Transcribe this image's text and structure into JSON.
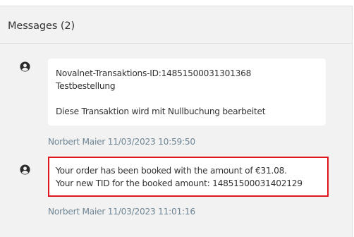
{
  "panel": {
    "title": "Messages (2)"
  },
  "messages": [
    {
      "avatar_icon": "user-icon",
      "lines": [
        "Novalnet-Transaktions-ID:14851500031301368",
        "Testbestellung",
        "",
        "Diese Transaktion wird mit Nullbuchung bearbeitet"
      ],
      "meta": "Norbert Maier 11/03/2023 10:59:50",
      "highlighted": false
    },
    {
      "avatar_icon": "user-icon",
      "lines": [
        "Your order has been booked with the amount of €31.08.",
        "Your new TID for the booked amount: 14851500031402129"
      ],
      "meta": "Norbert Maier 11/03/2023 11:01:16",
      "highlighted": true
    }
  ],
  "colors": {
    "panel_bg": "#f2f2f2",
    "bubble_bg": "#ffffff",
    "highlight_border": "#e0161e",
    "meta_text": "#6e8594"
  }
}
